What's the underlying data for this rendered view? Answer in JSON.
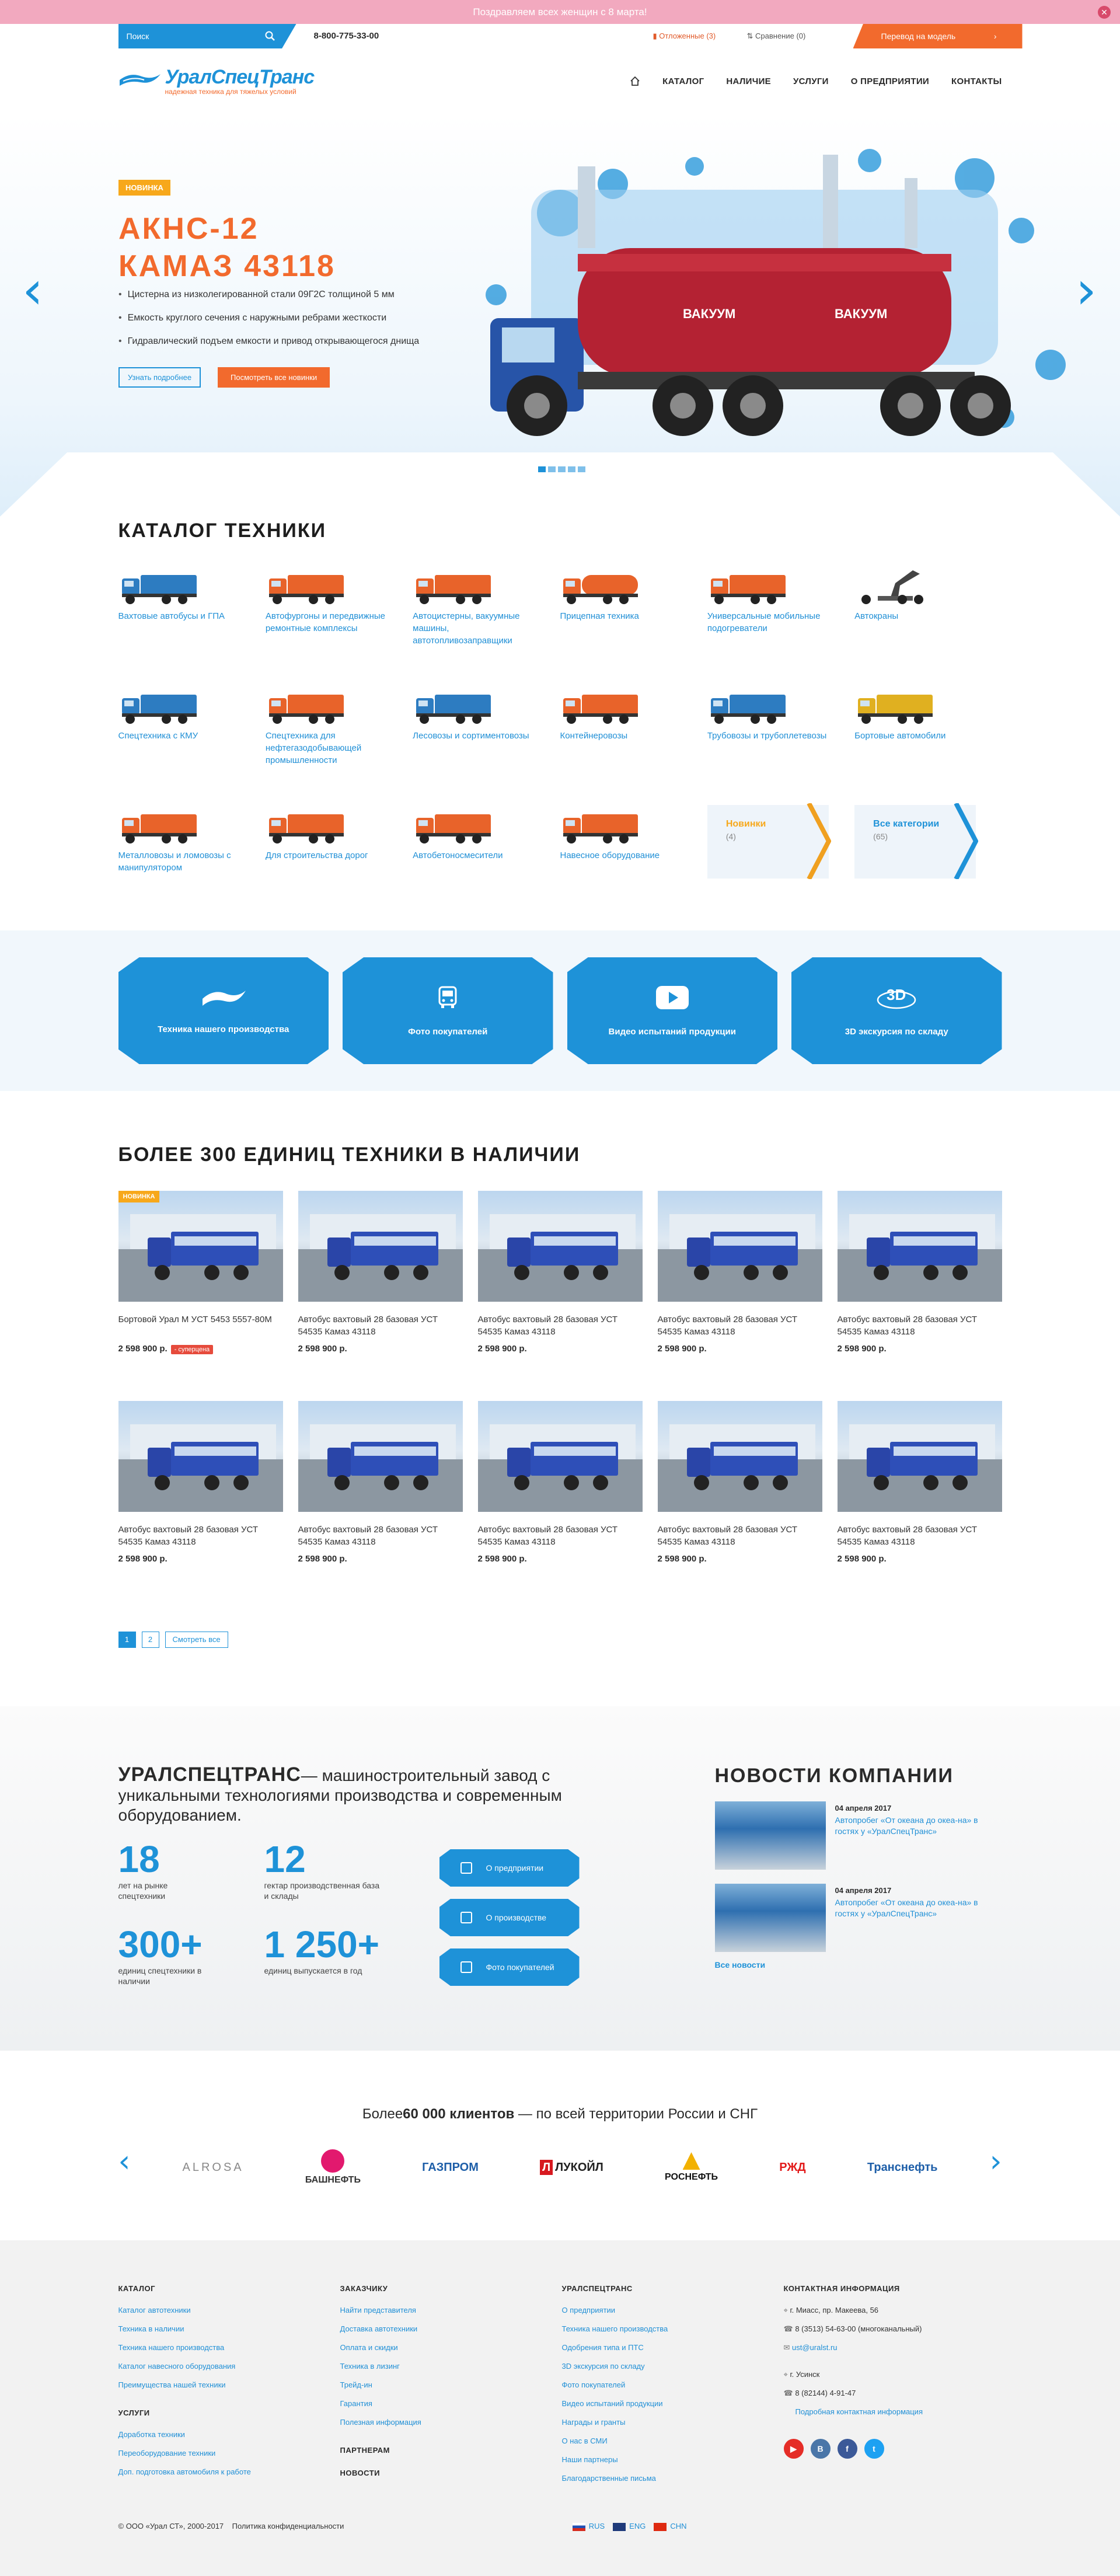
{
  "promo": {
    "text": "Поздравляем всех женщин с 8 марта!"
  },
  "topbar": {
    "search_placeholder": "Поиск",
    "phone": "8-800-775-33-00",
    "favorites": "Отложенные (3)",
    "compare": "Сравнение (0)",
    "model_link": "Перевод на модель"
  },
  "header": {
    "logo_title": "УралСпецТранс",
    "logo_sub": "надежная техника для тяжелых условий",
    "nav": [
      "КАТАЛОГ",
      "НАЛИЧИЕ",
      "УСЛУГИ",
      "О ПРЕДПРИЯТИИ",
      "КОНТАКТЫ"
    ]
  },
  "hero": {
    "badge": "НОВИНКА",
    "title_line1": "АКНС-12",
    "title_line2": "КАМАЗ 43118",
    "features": [
      "Цистерна из низколегированной стали 09Г2С толщиной 5 мм",
      "Емкость круглого сечения с наружными ребрами жесткости",
      "Гидравлический подъем емкости и привод открывающегося днища"
    ],
    "btn_more": "Узнать подробнее",
    "btn_all": "Посмотреть все новинки",
    "tank_label": "ВАКУУМ"
  },
  "catalog": {
    "title": "КАТАЛОГ ТЕХНИКИ",
    "items": [
      {
        "label": "Вахтовые автобусы и ГПА",
        "color": "#2d7cc1"
      },
      {
        "label": "Автофургоны и передвижные ремонтные комплексы",
        "color": "#e8632a"
      },
      {
        "label": "Автоцистерны, вакуумные машины, автотопливозаправщики",
        "color": "#e8632a"
      },
      {
        "label": "Прицепная техника",
        "color": "#e8632a"
      },
      {
        "label": "Универсальные мобильные подогреватели",
        "color": "#e8632a"
      },
      {
        "label": "Автокраны",
        "color": "#555555"
      },
      {
        "label": "Спецтехника с КМУ",
        "color": "#2d7cc1"
      },
      {
        "label": "Спецтехника для нефтегазодобывающей промышленности",
        "color": "#e8632a"
      },
      {
        "label": "Лесовозы и сортиментовозы",
        "color": "#2d7cc1"
      },
      {
        "label": "Контейнеровозы",
        "color": "#e8632a"
      },
      {
        "label": "Трубовозы и трубоплетевозы",
        "color": "#2d7cc1"
      },
      {
        "label": "Бортовые автомобили",
        "color": "#e0b020"
      },
      {
        "label": "Металловозы и ломовозы с манипулятором",
        "color": "#e8632a"
      },
      {
        "label": "Для строительства дорог",
        "color": "#e8632a"
      },
      {
        "label": "Автобетоносмесители",
        "color": "#e8632a"
      },
      {
        "label": "Навесное оборудование",
        "color": "#e8632a"
      }
    ],
    "new_label": "Новинки",
    "new_count": "(4)",
    "all_label": "Все категории",
    "all_count": "(65)"
  },
  "tiles": [
    {
      "label": "Техника нашего производства",
      "icon": "logo-icon"
    },
    {
      "label": "Фото покупателей",
      "icon": "bus-icon"
    },
    {
      "label": "Видео испытаний продукции",
      "icon": "play-icon"
    },
    {
      "label": "3D экскурсия по складу",
      "icon": "3d-icon"
    }
  ],
  "stock": {
    "title": "БОЛЕЕ 300 ЕДИНИЦ ТЕХНИКИ В НАЛИЧИИ",
    "new_badge": "НОВИНКА",
    "sale_badge": "- суперцена",
    "products": [
      {
        "name": "Бортовой Урал М УСТ 5453 5557-80М",
        "price": "2 598 900 р."
      },
      {
        "name": "Автобус вахтовый 28 базовая УСТ 54535 Камаз 43118",
        "price": "2 598 900 р."
      },
      {
        "name": "Автобус вахтовый 28 базовая УСТ 54535 Камаз 43118",
        "price": "2 598 900 р."
      },
      {
        "name": "Автобус вахтовый 28 базовая УСТ 54535 Камаз 43118",
        "price": "2 598 900 р."
      },
      {
        "name": "Автобус вахтовый 28 базовая УСТ 54535 Камаз 43118",
        "price": "2 598 900 р."
      },
      {
        "name": "Автобус вахтовый 28 базовая УСТ 54535 Камаз 43118",
        "price": "2 598 900 р."
      },
      {
        "name": "Автобус вахтовый 28 базовая УСТ 54535 Камаз 43118",
        "price": "2 598 900 р."
      },
      {
        "name": "Автобус вахтовый 28 базовая УСТ 54535 Камаз 43118",
        "price": "2 598 900 р."
      },
      {
        "name": "Автобус вахтовый 28 базовая УСТ 54535 Камаз 43118",
        "price": "2 598 900 р."
      },
      {
        "name": "Автобус вахтовый 28 базовая УСТ 54535 Камаз 43118",
        "price": "2 598 900 р."
      }
    ],
    "pages": [
      "1",
      "2"
    ],
    "show_all": "Смотреть все"
  },
  "about": {
    "brand": "УРАЛСПЕЦТРАНС",
    "text": "— машиностроительный завод с уникальными технологиями производства и современным оборудованием.",
    "stats": [
      {
        "value": "18",
        "desc": "лет на рынке спецтехники"
      },
      {
        "value": "12",
        "desc": "гектар производственная база и склады"
      },
      {
        "value": "300+",
        "desc": "единиц спецтехники в наличии"
      },
      {
        "value": "1 250+",
        "desc": "единиц выпускается в год"
      }
    ],
    "buttons": [
      "О предприятии",
      "О производстве",
      "Фото покупателей"
    ]
  },
  "news": {
    "title": "НОВОСТИ КОМПАНИИ",
    "items": [
      {
        "date": "04 апреля 2017",
        "text": "Автопробег «От океана до океа-на» в гостях у «УралСпецТранс»"
      },
      {
        "date": "04 апреля 2017",
        "text": "Автопробег «От океана до океа-на» в гостях у «УралСпецТранс»"
      }
    ],
    "all": "Все новости"
  },
  "clients": {
    "prefix": "Более",
    "count": "60 000 клиентов",
    "suffix": " — по всей территории России и СНГ",
    "logos": [
      "ALROSA",
      "БАШНЕФТЬ",
      "ГАЗПРОМ",
      "ЛУКОЙЛ",
      "РОСНЕФТЬ",
      "РЖД",
      "Транснефть"
    ]
  },
  "footer": {
    "col1_title": "КАТАЛОГ",
    "col1": [
      "Каталог автотехники",
      "Техника в наличии",
      "Техника нашего производства",
      "Каталог навесного оборудования",
      "Преимущества нашей техники"
    ],
    "col1b_title": "УСЛУГИ",
    "col1b": [
      "Доработка техники",
      "Переоборудование техники",
      "Доп. подготовка автомобиля к работе"
    ],
    "col2_title": "ЗАКАЗЧИКУ",
    "col2": [
      "Найти представителя",
      "Доставка автотехники",
      "Оплата и скидки",
      "Техника в лизинг",
      "Трейд-ин",
      "Гарантия",
      "Полезная информация"
    ],
    "col2b_title": "ПАРТНЕРАМ",
    "col2c_title": "НОВОСТИ",
    "col3_title": "УРАЛСПЕЦТРАНС",
    "col3": [
      "О предприятии",
      "Техника нашего производства",
      "Одобрения типа и ПТС",
      "3D экскурсия по складу",
      "Фото покупателей",
      "Видео испытаний продукции",
      "Награды и гранты",
      "О нас в СМИ",
      "Наши партнеры",
      "Благодарственные письма"
    ],
    "col4_title": "КОНТАКТНАЯ ИНФОРМАЦИЯ",
    "contact": [
      "г. Миасс, пр. Макеева, 56",
      "8 (3513) 54-63-00 (многоканальный)",
      "ust@uralst.ru",
      "г. Усинск",
      "8 (82144) 4-91-47",
      "Подробная контактная информация"
    ],
    "copyright": "© ООО «Урал СТ», 2000-2017",
    "privacy": "Политика конфиденциальности",
    "langs": [
      "RUS",
      "ENG",
      "CHN"
    ]
  },
  "colors": {
    "accent": "#1e92d8",
    "orange": "#f26a2d",
    "badge": "#f7a81b"
  }
}
